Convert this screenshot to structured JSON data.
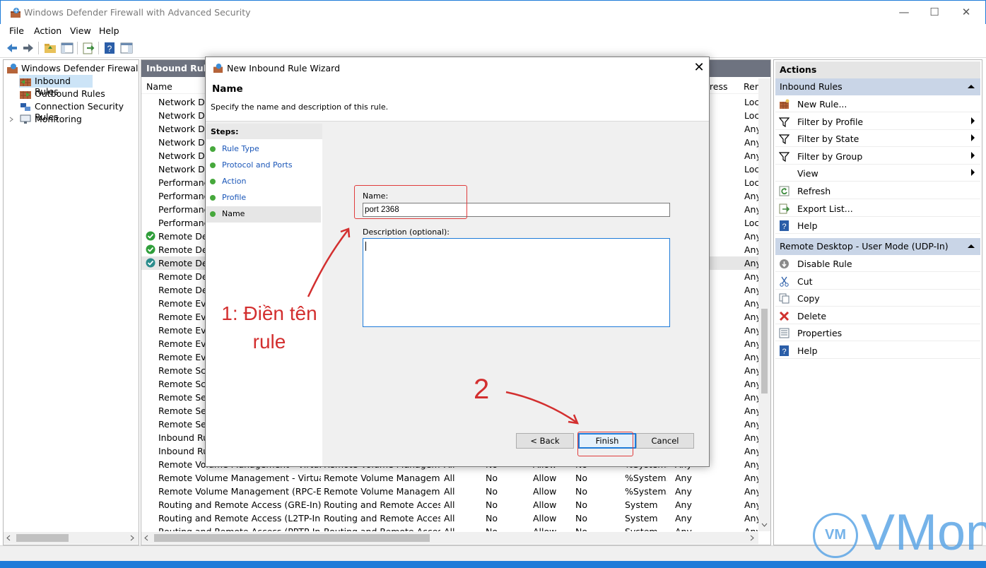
{
  "window": {
    "title": "Windows Defender Firewall with Advanced Security",
    "minimize": "—",
    "maximize": "☐",
    "close": "✕"
  },
  "menu": [
    "File",
    "Action",
    "View",
    "Help"
  ],
  "tree": {
    "root": "Windows Defender Firewall with",
    "items": [
      {
        "label": "Inbound Rules"
      },
      {
        "label": "Outbound Rules"
      },
      {
        "label": "Connection Security Rules"
      },
      {
        "label": "Monitoring"
      }
    ]
  },
  "list": {
    "header": "Inbound Rules",
    "columns": [
      "Name",
      "dress",
      "Ren"
    ],
    "rows": [
      {
        "name": "Network Disc",
        "col9": "Loc"
      },
      {
        "name": "Network Disc",
        "col9": "Loc"
      },
      {
        "name": "Network Disc",
        "col9": "Any"
      },
      {
        "name": "Network Disc",
        "col9": "Any"
      },
      {
        "name": "Network Disc",
        "col9": "Any"
      },
      {
        "name": "Network Disc",
        "col9": "Loc"
      },
      {
        "name": "Performance",
        "col9": "Loc"
      },
      {
        "name": "Performance",
        "col9": "Any"
      },
      {
        "name": "Performance",
        "col9": "Any"
      },
      {
        "name": "Performance",
        "col9": "Loc"
      },
      {
        "name": "Remote Desk",
        "col9": "Any",
        "status": "enabled"
      },
      {
        "name": "Remote Desk",
        "col9": "Any",
        "status": "enabled"
      },
      {
        "name": "Remote Desk",
        "col9": "Any",
        "status": "selected"
      },
      {
        "name": "Remote Desk",
        "col9": "Any"
      },
      {
        "name": "Remote Desk",
        "col9": "Any"
      },
      {
        "name": "Remote Even",
        "col9": "Any"
      },
      {
        "name": "Remote Even",
        "col9": "Any"
      },
      {
        "name": "Remote Even",
        "col9": "Any"
      },
      {
        "name": "Remote Even",
        "col9": "Any"
      },
      {
        "name": "Remote Even",
        "col9": "Any"
      },
      {
        "name": "Remote Sche",
        "col9": "Any"
      },
      {
        "name": "Remote Sche",
        "col9": "Any"
      },
      {
        "name": "Remote Servi",
        "col9": "Any"
      },
      {
        "name": "Remote Servi",
        "col9": "Any"
      },
      {
        "name": "Remote Servi",
        "col9": "Any"
      },
      {
        "name": "Inbound Rule",
        "col9": "Any"
      },
      {
        "name": "Inbound Rule",
        "col9": "Any"
      },
      {
        "name": "Remote Volume Management - Virtual Di...",
        "group": "Remote Volume Management",
        "profile": "All",
        "enabled": "No",
        "action": "Allow",
        "override": "No",
        "program": "%System...",
        "local": "Any",
        "col9": "Any"
      },
      {
        "name": "Remote Volume Management - Virtual Di...",
        "group": "Remote Volume Management",
        "profile": "All",
        "enabled": "No",
        "action": "Allow",
        "override": "No",
        "program": "%System...",
        "local": "Any",
        "col9": "Any"
      },
      {
        "name": "Remote Volume Management (RPC-EPM...",
        "group": "Remote Volume Management",
        "profile": "All",
        "enabled": "No",
        "action": "Allow",
        "override": "No",
        "program": "%System...",
        "local": "Any",
        "col9": "Any"
      },
      {
        "name": "Routing and Remote Access (GRE-In)",
        "group": "Routing and Remote Access",
        "profile": "All",
        "enabled": "No",
        "action": "Allow",
        "override": "No",
        "program": "System",
        "local": "Any",
        "col9": "Any"
      },
      {
        "name": "Routing and Remote Access (L2TP-In)",
        "group": "Routing and Remote Access",
        "profile": "All",
        "enabled": "No",
        "action": "Allow",
        "override": "No",
        "program": "System",
        "local": "Any",
        "col9": "Any"
      },
      {
        "name": "Routing and Remote Access (PPTP-In)",
        "group": "Routing and Remote Access",
        "profile": "All",
        "enabled": "No",
        "action": "Allow",
        "override": "No",
        "program": "System",
        "local": "Any",
        "col9": "Any"
      }
    ]
  },
  "actions": {
    "title": "Actions",
    "section1": "Inbound Rules",
    "items1": [
      {
        "label": "New Rule...",
        "icon": "new-rule-icon"
      },
      {
        "label": "Filter by Profile",
        "icon": "filter-icon",
        "submenu": true
      },
      {
        "label": "Filter by State",
        "icon": "filter-icon",
        "submenu": true
      },
      {
        "label": "Filter by Group",
        "icon": "filter-icon",
        "submenu": true
      },
      {
        "label": "View",
        "icon": "",
        "submenu": true
      },
      {
        "label": "Refresh",
        "icon": "refresh-icon"
      },
      {
        "label": "Export List...",
        "icon": "export-icon"
      },
      {
        "label": "Help",
        "icon": "help-icon"
      }
    ],
    "section2": "Remote Desktop - User Mode (UDP-In)",
    "items2": [
      {
        "label": "Disable Rule",
        "icon": "disable-icon"
      },
      {
        "label": "Cut",
        "icon": "cut-icon"
      },
      {
        "label": "Copy",
        "icon": "copy-icon"
      },
      {
        "label": "Delete",
        "icon": "delete-icon"
      },
      {
        "label": "Properties",
        "icon": "properties-icon"
      },
      {
        "label": "Help",
        "icon": "help-icon"
      }
    ]
  },
  "wizard": {
    "title": "New Inbound Rule Wizard",
    "close": "✕",
    "page_title": "Name",
    "page_subtitle": "Specify the name and description of this rule.",
    "steps_header": "Steps:",
    "steps": [
      "Rule Type",
      "Protocol and Ports",
      "Action",
      "Profile",
      "Name"
    ],
    "name_label": "Name:",
    "name_value": "port 2368",
    "description_label": "Description (optional):",
    "description_value": "",
    "back_button": "< Back",
    "finish_button": "Finish",
    "cancel_button": "Cancel"
  },
  "annotations": {
    "note1": "1: Điền tên rule",
    "note2": "2",
    "color": "#d32f2f"
  },
  "watermark": {
    "badge": "VM",
    "text": "VMon"
  },
  "colors": {
    "accent": "#1e7bd9",
    "header_dark": "#6e7380",
    "section_blue": "#c9d5e7",
    "step_dot": "#46a83c"
  }
}
